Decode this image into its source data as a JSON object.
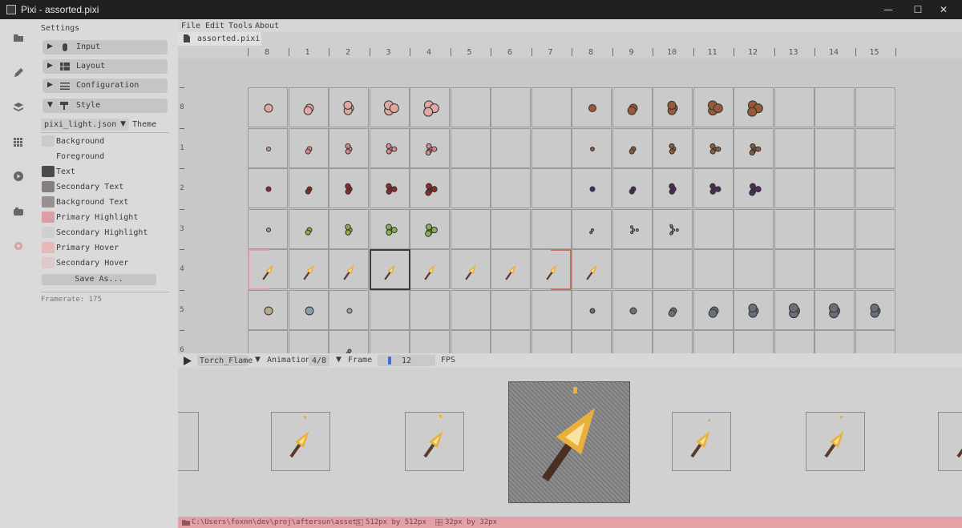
{
  "window": {
    "title": "Pixi - assorted.pixi"
  },
  "rail": {
    "icons": [
      "folder-icon",
      "pencil-icon",
      "layers-icon",
      "grid-icon",
      "play-icon",
      "palette-box-icon",
      "gear-icon"
    ]
  },
  "settings": {
    "title": "Settings",
    "sections": [
      {
        "label": "Input",
        "arrow": "▶",
        "icon": "mouse-icon"
      },
      {
        "label": "Layout",
        "arrow": "▶",
        "icon": "table-icon"
      },
      {
        "label": "Configuration",
        "arrow": "▶",
        "icon": "sliders-icon"
      },
      {
        "label": "Style",
        "arrow": "▼",
        "icon": "paint-roller-icon"
      }
    ],
    "theme": {
      "value": "pixi_light.json",
      "label": "Theme"
    },
    "colors": [
      {
        "label": "Background",
        "color": "#cbcbcb"
      },
      {
        "label": "Foreground",
        "color": "#dadada"
      },
      {
        "label": "Text",
        "color": "#4a4a4a"
      },
      {
        "label": "Secondary Text",
        "color": "#858080"
      },
      {
        "label": "Background Text",
        "color": "#9a9090"
      },
      {
        "label": "Primary Highlight",
        "color": "#dc9ea2"
      },
      {
        "label": "Secondary Highlight",
        "color": "#cfcfcf"
      },
      {
        "label": "Primary Hover",
        "color": "#e8b8b8"
      },
      {
        "label": "Secondary Hover",
        "color": "#dfcaca"
      }
    ],
    "save_as": "Save As...",
    "framerate": "Framerate: 175"
  },
  "menu": {
    "items": [
      "File",
      "Edit",
      "Tools",
      "About"
    ]
  },
  "tab": {
    "label": "assorted.pixi"
  },
  "ruler": {
    "top": [
      "8",
      "1",
      "2",
      "3",
      "4",
      "5",
      "6",
      "7",
      "8",
      "9",
      "10",
      "11",
      "12",
      "13",
      "14",
      "15"
    ],
    "left": [
      "8",
      "1",
      "2",
      "3",
      "4",
      "5",
      "6"
    ]
  },
  "animation": {
    "name": "Torch_Flame",
    "animation_label": "Animation",
    "frame_value": "4/8",
    "frame_label": "Frame",
    "fps_value": "12",
    "fps_label": "FPS"
  },
  "status": {
    "path": "C:\\Users\\foxnn\\dev\\proj\\aftersun\\assets",
    "canvas_size": "512px by 512px",
    "tile_size": "32px by 32px"
  },
  "colors": {
    "accent": "#dc9ea2",
    "selection": "#3a3a3a",
    "anim_range": "#c4735c",
    "checker_a": "#8f8f8f",
    "checker_b": "#7a7a7a"
  }
}
